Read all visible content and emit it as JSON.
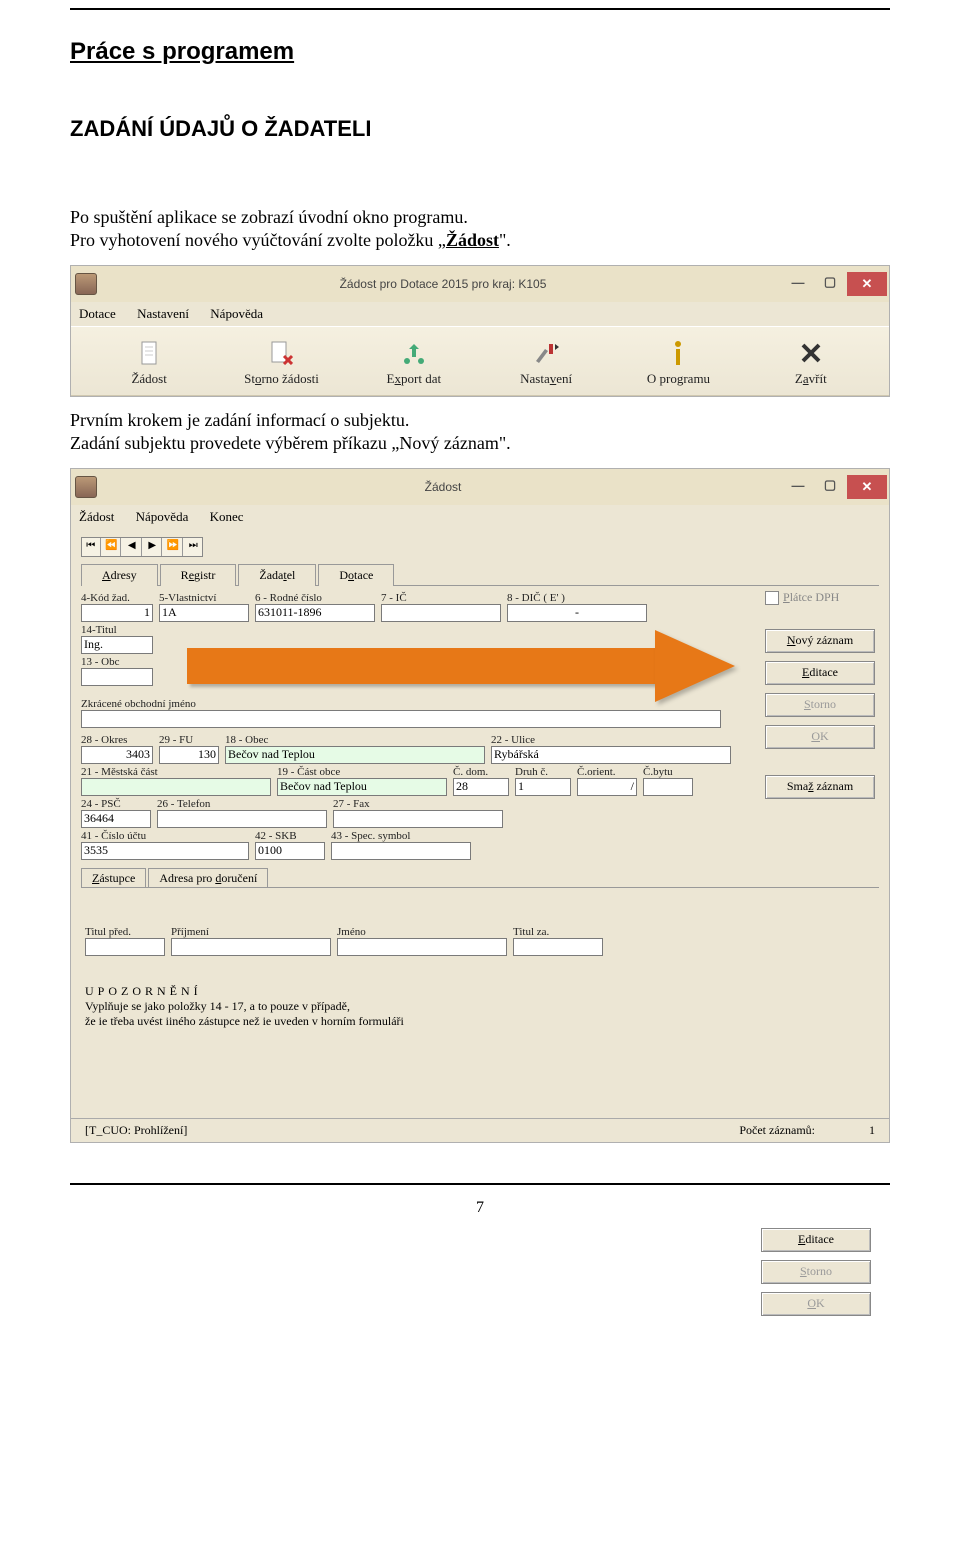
{
  "doc": {
    "h1": "Práce s programem",
    "h2": "ZADÁNÍ ÚDAJŮ O ŽADATELI",
    "p1_a": "Po spuštění aplikace se zobrazí úvodní okno programu.",
    "p1_b": "Pro vyhotovení nového vyúčtování zvolte položku „",
    "p1_bold": "Žádost",
    "p1_c": "\".",
    "p2_a": "Prvním krokem je zadání informací o subjektu.",
    "p2_b": "Zadání subjektu provedete výběrem příkazu „Nový záznam\".",
    "page_no": "7"
  },
  "win1": {
    "title": "Žádost pro Dotace 2015  pro kraj: K105",
    "menu": [
      "Dotace",
      "Nastavení",
      "Nápověda"
    ],
    "tb": {
      "zadost": "Žádost",
      "st_a": "St",
      "st_b": "o",
      "st_c": "rno žádosti",
      "exp_a": "E",
      "exp_b": "x",
      "exp_c": "port dat",
      "nas_a": "Nasta",
      "nas_b": "v",
      "nas_c": "ení",
      "about": "O programu",
      "zav_a": "Z",
      "zav_b": "a",
      "zav_c": "vřít"
    }
  },
  "win2": {
    "title": "Žádost",
    "menu": [
      "Žádost",
      "Nápověda",
      "Konec"
    ],
    "tabs": {
      "adr_a": "A",
      "adr_b": "d",
      "adr_c": "resy",
      "reg_a": "R",
      "reg_b": "e",
      "reg_c": "gistr",
      "zad_a": "Žada",
      "zad_b": "t",
      "zad_c": "el",
      "dot_a": "D",
      "dot_b": "o",
      "dot_c": "tace"
    },
    "chk_a": "P",
    "chk_b": "látce DPH",
    "btns": {
      "novy_a": "N",
      "novy_b": "ový záznam",
      "edit_a": "E",
      "edit_b": "ditace",
      "storno_a": "S",
      "storno_b": "torno",
      "ok_a": "O",
      "ok_b": "K",
      "smaz_a": "Sma",
      "smaz_b": "ž",
      "smaz_c": " záznam"
    },
    "btns2": {
      "edit_a": "E",
      "edit_b": "ditace",
      "storno_a": "S",
      "storno_b": "torno",
      "ok_a": "O",
      "ok_b": "K"
    },
    "lbl": {
      "f4": "4-Kód žad.",
      "f5": "5-Vlastnictví",
      "f6": "6 - Rodné číslo",
      "f7": "7 - IČ",
      "f8": "8 - DIČ ( E'    )",
      "f14": "14-Titul",
      "f13": "13 - Obc",
      "zkr": "Zkrácené obchodní jméno",
      "f28": "28 - Okres",
      "f29": "29 - FU",
      "f18": "18 - Obec",
      "f22": "22 - Ulice",
      "f21": "21 - Městská část",
      "f19": "19 - Část obce",
      "cdom": "Č. dom.",
      "druh": "Druh č.",
      "corient": "Č.orient.",
      "cbytu": "Č.bytu",
      "f24": "24 - PSČ",
      "f26": "26 - Telefon",
      "f27": "27 - Fax",
      "f41": "41 - Číslo účtu",
      "f42": "42 - SKB",
      "f43": "43 - Spec. symbol",
      "tp": "Titul před.",
      "prij": "Příjmení",
      "jm": "Jméno",
      "tz": "Titul za."
    },
    "val": {
      "f4": "1",
      "f5": "1A",
      "f6": "631011-1896",
      "f7": "",
      "f8": "-",
      "f14": "Ing.",
      "f13": "",
      "zkr": "",
      "f28": "3403",
      "f29": "130",
      "f18": "Bečov nad Teplou",
      "f22": "Rybářská",
      "f21": "",
      "f19": "Bečov nad Teplou",
      "cdom": "28",
      "druh": "1",
      "corient": "/",
      "cbytu": "",
      "f24": "36464",
      "f26": "",
      "f27": "",
      "f41": "3535",
      "f42": "0100",
      "f43": ""
    },
    "subtabs": {
      "zast_a": "Z",
      "zast_b": "ástupce",
      "adr_a": "Adresa pro ",
      "adr_b": "d",
      "adr_c": "oručení"
    },
    "warn_t": "UPOZORNĚNÍ",
    "warn_l1": "Vyplňuje se jako položky 14 - 17, a to pouze v případě,",
    "warn_l2": "že ie třeba uvést iiného zástupce než ie uveden v horním formuláři",
    "status_l": "[T_CUO: Prohlížení]",
    "status_r": "Počet záznamů:",
    "status_n": "1"
  }
}
